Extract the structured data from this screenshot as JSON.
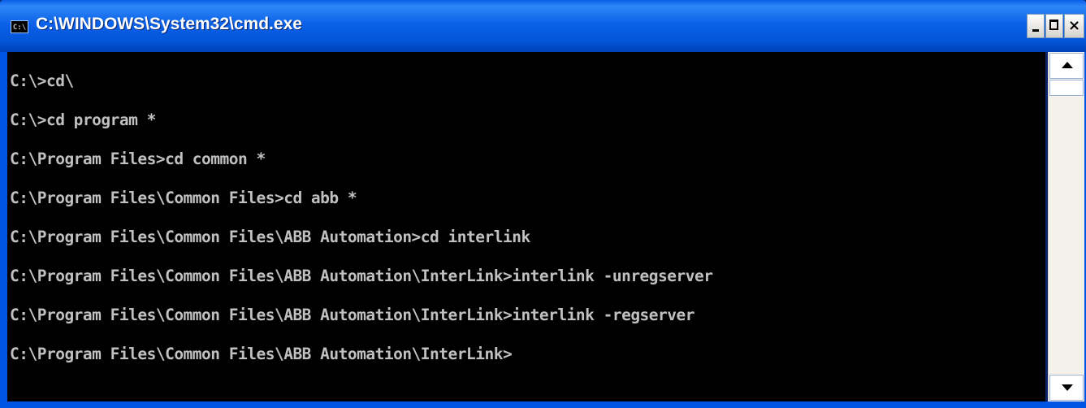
{
  "window": {
    "title": "C:\\WINDOWS\\System32\\cmd.exe",
    "icon_text": "C:\\"
  },
  "controls": {
    "close_glyph": "×"
  },
  "console": {
    "lines": [
      "C:\\>cd\\",
      "C:\\>cd program *",
      "C:\\Program Files>cd common *",
      "C:\\Program Files\\Common Files>cd abb *",
      "C:\\Program Files\\Common Files\\ABB Automation>cd interlink",
      "C:\\Program Files\\Common Files\\ABB Automation\\InterLink>interlink -unregserver",
      "C:\\Program Files\\Common Files\\ABB Automation\\InterLink>interlink -regserver",
      "C:\\Program Files\\Common Files\\ABB Automation\\InterLink>"
    ]
  },
  "colors": {
    "titlebar": "#0054e3",
    "console_bg": "#000000",
    "console_text": "#c0c0c0"
  }
}
